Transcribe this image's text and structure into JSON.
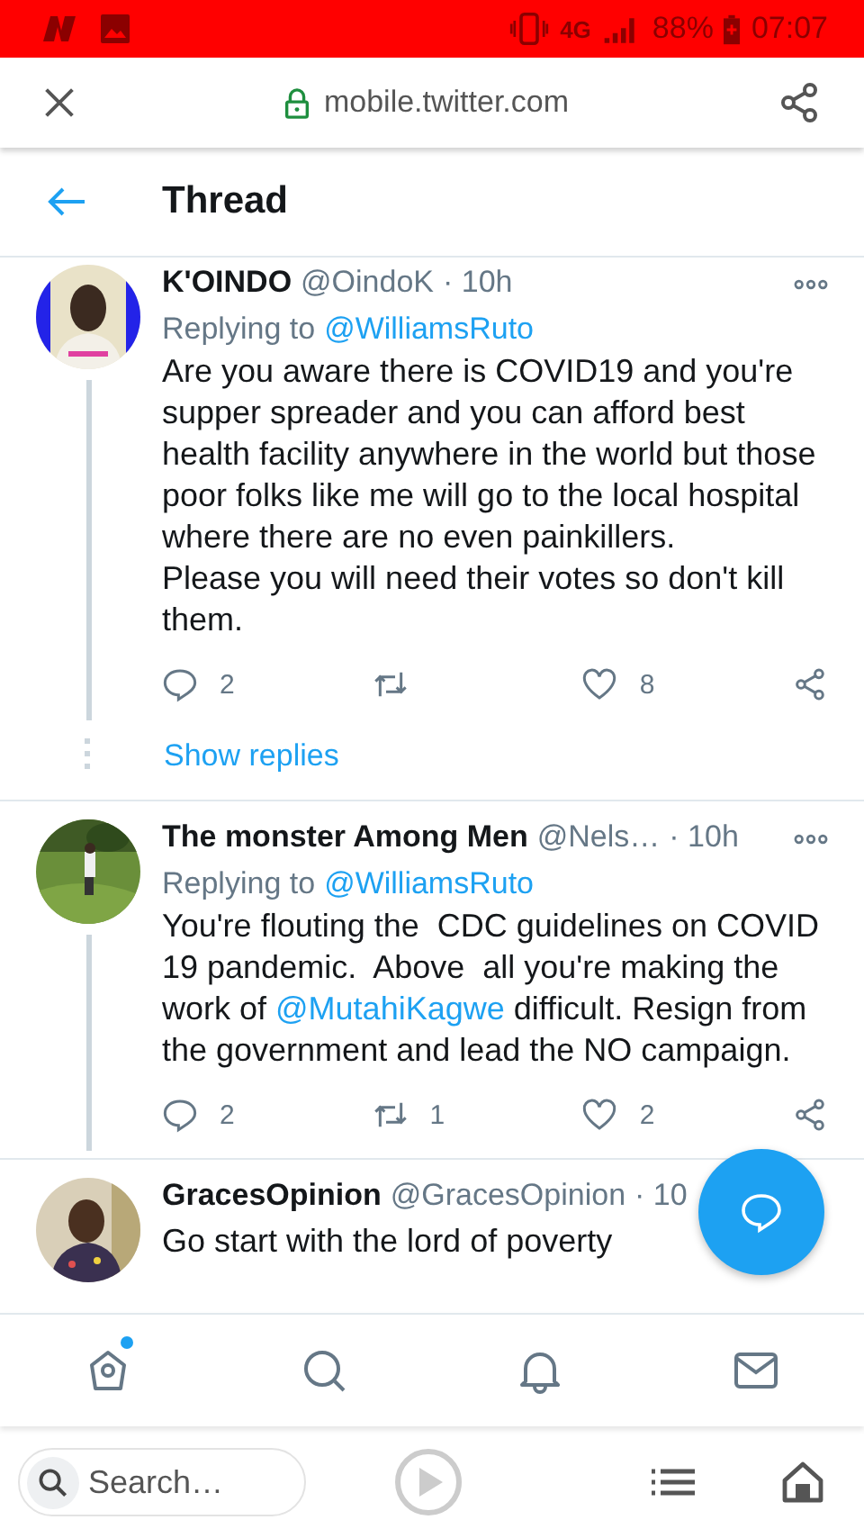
{
  "status_bar": {
    "network": "4G",
    "battery": "88%",
    "time": "07:07"
  },
  "browser": {
    "url": "mobile.twitter.com"
  },
  "header": {
    "title": "Thread"
  },
  "tweets": [
    {
      "name": "K'OINDO",
      "handle": "@OindoK",
      "time": "· 10h",
      "replying_label": "Replying to",
      "replying_to": "@WilliamsRuto",
      "options_menu": true,
      "connected": true,
      "body": [
        {
          "kind": "text",
          "text": "Are you aware there is COVID19 and you're supper spreader and you can afford best health facility anywhere in the world but those poor folks like me will go to the local hospital where there are no even painkillers.\nPlease you will need their votes so don't kill them."
        }
      ],
      "actions": {
        "replies": "2",
        "likes": "8"
      },
      "show_replies": "Show replies"
    },
    {
      "name": "The monster Among Men",
      "handle": "@Nels…",
      "time": "· 10h",
      "replying_label": "Replying to",
      "replying_to": "@WilliamsRuto",
      "options_menu": true,
      "connected": true,
      "body": [
        {
          "kind": "text",
          "text": "You're flouting the  CDC guidelines on COVID 19 pandemic.  Above  all you're making the work of "
        },
        {
          "kind": "mention",
          "text": "@MutahiKagwe"
        },
        {
          "kind": "text",
          "text": " difficult. Resign from the government and lead the NO campaign."
        }
      ],
      "actions": {
        "replies": "2",
        "retweets": "1",
        "likes": "2"
      }
    },
    {
      "name": "GracesOpinion",
      "handle": "@GracesOpinion",
      "time": "· 10",
      "options_menu": false,
      "connected": false,
      "body": [
        {
          "kind": "text",
          "text": "Go start with the lord of poverty"
        }
      ]
    }
  ],
  "nav": [
    {
      "kind": "home",
      "badge": true
    },
    {
      "kind": "search",
      "badge": false
    },
    {
      "kind": "bell",
      "badge": false
    },
    {
      "kind": "mail",
      "badge": false
    }
  ],
  "browser_bottom": {
    "search_placeholder": "Search…"
  }
}
